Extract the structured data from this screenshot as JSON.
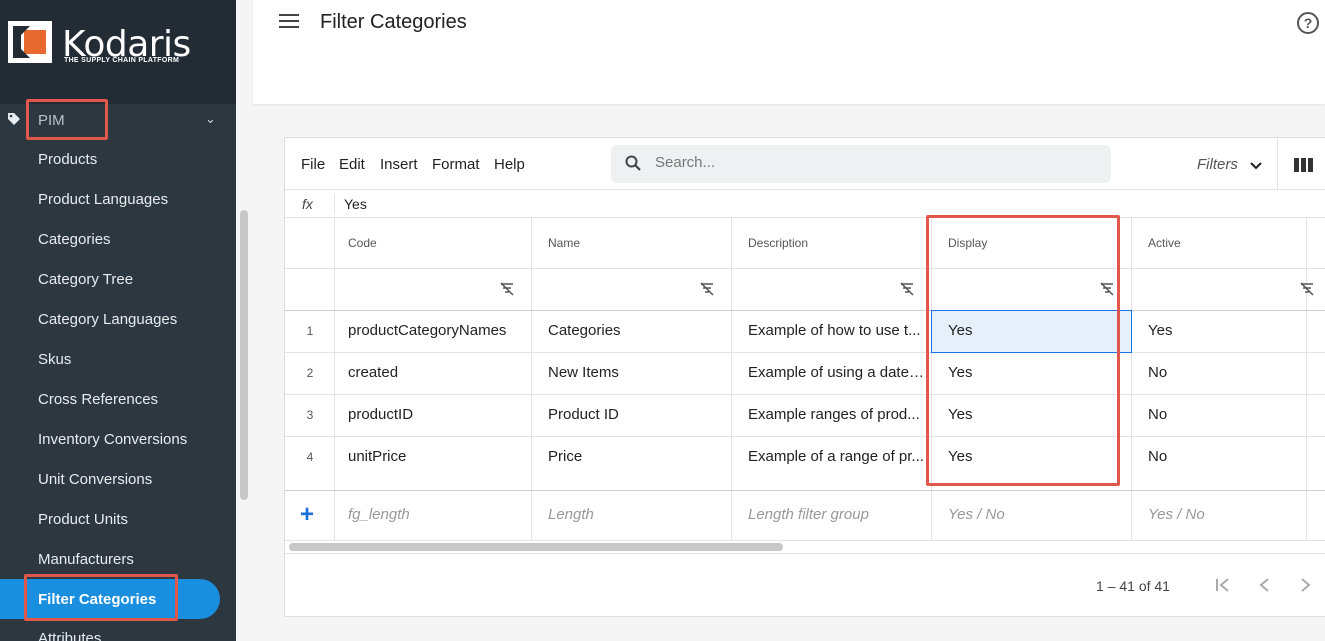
{
  "brand": {
    "name": "Kodaris",
    "tagline": "THE SUPPLY CHAIN PLATFORM"
  },
  "sidebar": {
    "section": {
      "label": "PIM",
      "icon": "tag-icon"
    },
    "items": [
      {
        "label": "Products"
      },
      {
        "label": "Product Languages"
      },
      {
        "label": "Categories"
      },
      {
        "label": "Category Tree"
      },
      {
        "label": "Category Languages"
      },
      {
        "label": "Skus"
      },
      {
        "label": "Cross References"
      },
      {
        "label": "Inventory Conversions"
      },
      {
        "label": "Unit Conversions"
      },
      {
        "label": "Product Units"
      },
      {
        "label": "Manufacturers"
      },
      {
        "label": "Filter Categories",
        "active": true
      },
      {
        "label": "Attributes"
      }
    ]
  },
  "header": {
    "title": "Filter Categories"
  },
  "menu": [
    "File",
    "Edit",
    "Insert",
    "Format",
    "Help"
  ],
  "search": {
    "placeholder": "Search..."
  },
  "filters_label": "Filters",
  "formula": {
    "label": "fx",
    "value": "Yes"
  },
  "table": {
    "columns": [
      "Code",
      "Name",
      "Description",
      "Display",
      "Active"
    ],
    "rows": [
      {
        "num": "1",
        "cells": [
          "productCategoryNames",
          "Categories",
          "Example of how to use t...",
          "Yes",
          "Yes"
        ]
      },
      {
        "num": "2",
        "cells": [
          "created",
          "New Items",
          "Example of using a date ...",
          "Yes",
          "No"
        ]
      },
      {
        "num": "3",
        "cells": [
          "productID",
          "Product ID",
          "Example ranges of prod...",
          "Yes",
          "No"
        ]
      },
      {
        "num": "4",
        "cells": [
          "unitPrice",
          "Price",
          "Example of a range of pr...",
          "Yes",
          "No"
        ]
      }
    ],
    "new_row": {
      "add": "+",
      "cells": [
        "fg_length",
        "Length",
        "Length filter group",
        "Yes / No",
        "Yes / No"
      ]
    }
  },
  "pagination": {
    "text": "1 – 41 of 41"
  },
  "colors": {
    "accent": "#1a8fe0",
    "highlight": "#e2574c",
    "sidebar": "#2c3740"
  }
}
